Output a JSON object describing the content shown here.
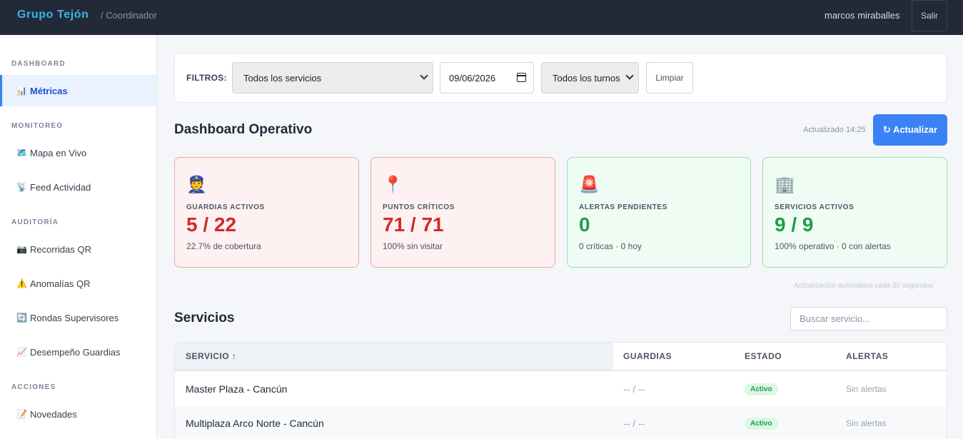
{
  "header": {
    "brand": "Grupo Tejón",
    "role": "/ Coordinador",
    "user": "marcos miraballes",
    "logout_label": "Salir"
  },
  "sidebar": {
    "sections": [
      {
        "title": "DASHBOARD",
        "items": [
          {
            "icon": "📊",
            "label": "Métricas",
            "active": true
          }
        ]
      },
      {
        "title": "MONITOREO",
        "items": [
          {
            "icon": "🗺️",
            "label": "Mapa en Vivo"
          },
          {
            "icon": "📡",
            "label": "Feed Actividad"
          }
        ]
      },
      {
        "title": "AUDITORÍA",
        "items": [
          {
            "icon": "📷",
            "label": "Recorridas QR"
          },
          {
            "icon": "⚠️",
            "label": "Anomalías QR"
          },
          {
            "icon": "🔄",
            "label": "Rondas Supervisores"
          },
          {
            "icon": "📈",
            "label": "Desempeño Guardias"
          }
        ]
      },
      {
        "title": "ACCIONES",
        "items": [
          {
            "icon": "📝",
            "label": "Novedades"
          }
        ]
      }
    ]
  },
  "filters": {
    "label": "FILTROS:",
    "service_value": "Todos los servicios",
    "date_value": "09/06/2026",
    "shift_value": "Todos los turnos",
    "clear_label": "Limpiar"
  },
  "dashboard": {
    "title": "Dashboard Operativo",
    "updated": "Actualizado 14:25",
    "refresh_label": "↻ Actualizar",
    "auto_note": "Actualización automática cada 30 segundos",
    "cards": [
      {
        "icon": "👮",
        "label": "GUARDIAS ACTIVOS",
        "value": "5 / 22",
        "sub": "22.7% de cobertura",
        "status": "critical"
      },
      {
        "icon": "📍",
        "label": "PUNTOS CRÍTICOS",
        "value": "71 / 71",
        "sub": "100% sin visitar",
        "status": "critical"
      },
      {
        "icon": "🚨",
        "label": "ALERTAS PENDIENTES",
        "value": "0",
        "sub": "0 críticas · 0 hoy",
        "status": "ok"
      },
      {
        "icon": "🏢",
        "label": "SERVICIOS ACTIVOS",
        "value": "9 / 9",
        "sub": "100% operativo · 0 con alertas",
        "status": "ok"
      }
    ]
  },
  "services": {
    "title": "Servicios",
    "search_placeholder": "Buscar servicio...",
    "columns": [
      "SERVICIO ↑",
      "GUARDIAS",
      "ESTADO",
      "ALERTAS"
    ],
    "rows": [
      {
        "name": "Master Plaza - Cancún",
        "guards": "-- / --",
        "status": "Activo",
        "alerts": "Sin alertas"
      },
      {
        "name": "Multiplaza Arco Norte - Cancún",
        "guards": "-- / --",
        "status": "Activo",
        "alerts": "Sin alertas"
      }
    ]
  },
  "colors": {
    "topbar": "#222a38",
    "brand": "#38b6e8",
    "accent": "#3b82f6",
    "critical": "#d12a2a",
    "ok": "#1f9d4c"
  }
}
